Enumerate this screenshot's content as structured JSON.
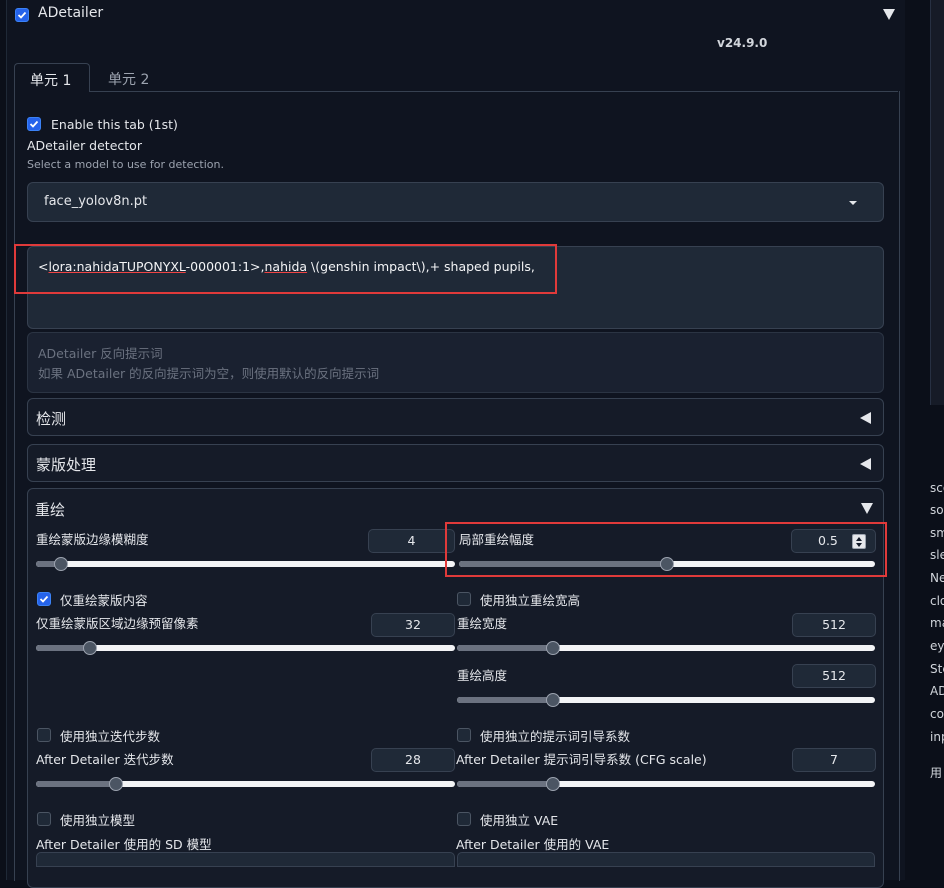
{
  "section": {
    "title": "ADetailer",
    "version": "v24.9.0"
  },
  "tabs": [
    {
      "label": "单元 1"
    },
    {
      "label": "单元 2"
    }
  ],
  "enable_tab": {
    "label": "Enable this tab (1st)"
  },
  "detector": {
    "title": "ADetailer detector",
    "hint": "Select a model to use for detection.",
    "selected": "face_yolov8n.pt"
  },
  "prompt": {
    "seg1": "<",
    "seg2": "lora:nahidaTUPONYXL",
    "seg3": "-000001:1>,",
    "seg4": "nahida",
    "seg5": " \\(genshin impact\\),+ shaped pupils,"
  },
  "negative_prompt": {
    "placeholder_line1": "ADetailer 反向提示词",
    "placeholder_line2": "如果 ADetailer 的反向提示词为空，则使用默认的反向提示词"
  },
  "accordions": {
    "detection": "检测",
    "mask": "蒙版处理",
    "inpaint": "重绘"
  },
  "inpaint": {
    "mask_blur": {
      "label": "重绘蒙版边缘模糊度",
      "value": "4",
      "fraction": 0.06
    },
    "denoise": {
      "label": "局部重绘幅度",
      "value": "0.5",
      "fraction": 0.5
    },
    "only_masked": {
      "label": "仅重绘蒙版内容",
      "checked": true
    },
    "padding": {
      "label": "仅重绘蒙版区域边缘预留像素",
      "value": "32",
      "fraction": 0.13
    },
    "use_sep_size": {
      "label": "使用独立重绘宽高",
      "checked": false
    },
    "width": {
      "label": "重绘宽度",
      "value": "512",
      "fraction": 0.23
    },
    "height": {
      "label": "重绘高度",
      "value": "512",
      "fraction": 0.23
    },
    "use_sep_steps": {
      "label": "使用独立迭代步数",
      "checked": false
    },
    "steps": {
      "label": "After Detailer 迭代步数",
      "value": "28",
      "fraction": 0.19
    },
    "use_sep_cfg": {
      "label": "使用独立的提示词引导系数",
      "checked": false
    },
    "cfg": {
      "label": "After Detailer 提示词引导系数 (CFG scale)",
      "value": "7",
      "fraction": 0.23
    },
    "use_sep_model": {
      "label": "使用独立模型",
      "checked": false
    },
    "sd_model": {
      "label": "After Detailer 使用的 SD 模型"
    },
    "use_sep_vae": {
      "label": "使用独立 VAE",
      "checked": false
    },
    "vae": {
      "label": "After Detailer 使用的 VAE"
    }
  },
  "right_panel": {
    "lines": [
      "sco",
      "so",
      "sm",
      "sle",
      "Ne",
      "clo",
      "ma",
      "ey",
      "Ste",
      "AD",
      "co",
      "inp",
      "用"
    ]
  },
  "colors": {
    "accent": "#2563eb",
    "highlight": "#e03a3a",
    "background": "#0b0f19"
  }
}
